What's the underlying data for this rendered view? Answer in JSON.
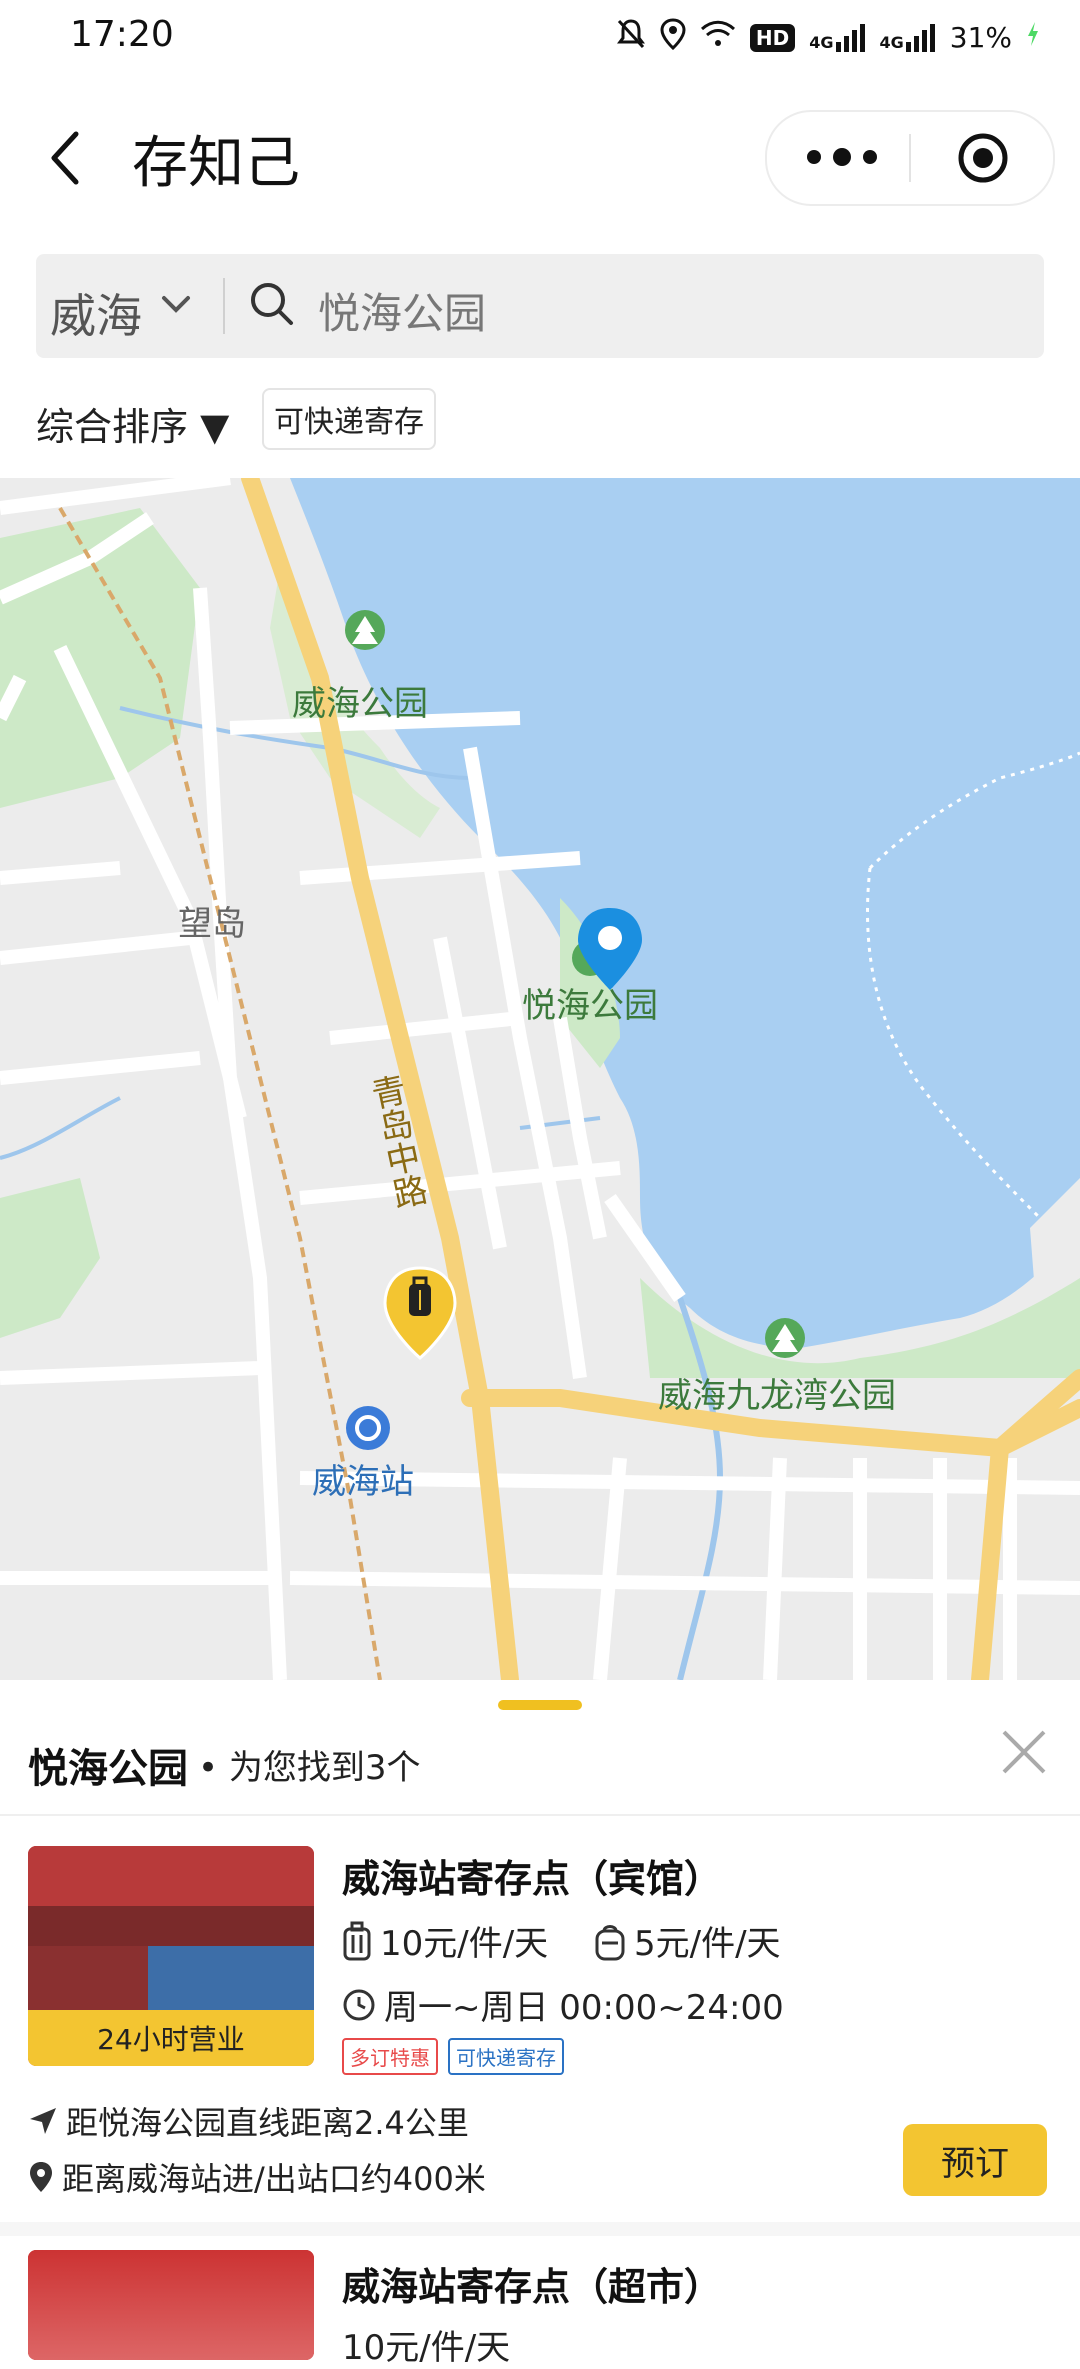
{
  "status_bar": {
    "time": "17:20",
    "hd": "HD",
    "network1": "4G",
    "network2": "4G",
    "battery": "31%"
  },
  "header": {
    "title": "存知己"
  },
  "search": {
    "city": "威海",
    "query": "悦海公园"
  },
  "filters": {
    "sort_label": "综合排序 ▼",
    "tag": "可快递寄存"
  },
  "map": {
    "labels": {
      "park1": "威海公园",
      "district": "望岛",
      "park2": "悦海公园",
      "road": "青岛中路",
      "station": "威海站",
      "park3": "威海九龙湾公园"
    },
    "colors": {
      "water": "#a9cff2",
      "park": "#cde9c7",
      "major_road": "#f6d27a",
      "marker_blue": "#1b8fe0",
      "marker_yellow": "#f3c531"
    }
  },
  "results": {
    "keyword": "悦海公园",
    "found_text": "• 为您找到3个",
    "items": [
      {
        "name": "威海站寄存点（宾馆）",
        "band": "24小时营业",
        "price_luggage": "10元/件/天",
        "price_bag": "5元/件/天",
        "hours": "周一~周日 00:00~24:00",
        "badges": [
          "多订特惠",
          "可快递寄存"
        ],
        "distance_line": "距悦海公园直线距离2.4公里",
        "station_line": "距离威海站进/出站口约400米",
        "book_label": "预订"
      },
      {
        "name": "威海站寄存点（超市）",
        "price_partial": "10元/件/天"
      }
    ]
  }
}
